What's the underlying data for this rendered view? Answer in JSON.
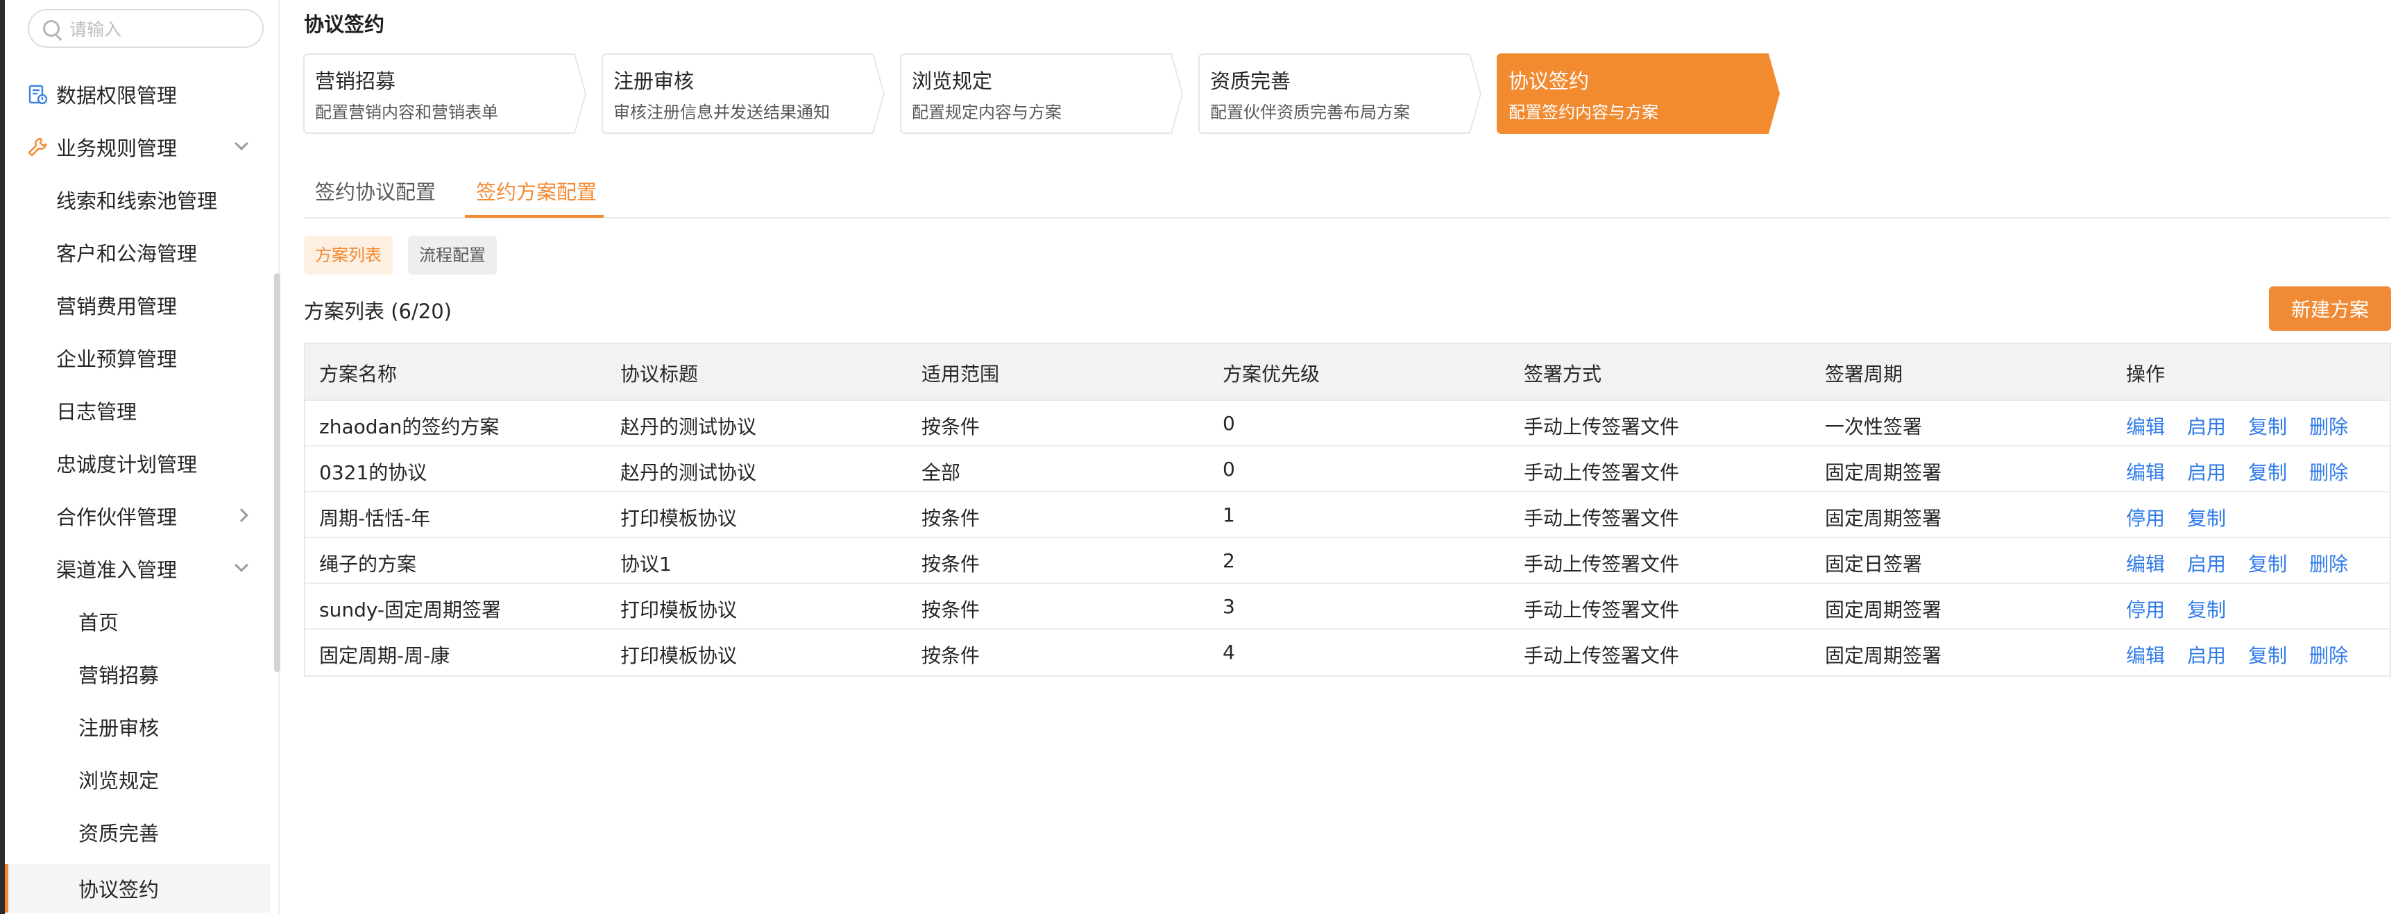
{
  "search": {
    "placeholder": "请输入"
  },
  "sidebar": {
    "items": [
      {
        "label": "数据权限管理"
      },
      {
        "label": "业务规则管理"
      },
      {
        "label": "线索和线索池管理"
      },
      {
        "label": "客户和公海管理"
      },
      {
        "label": "营销费用管理"
      },
      {
        "label": "企业预算管理"
      },
      {
        "label": "日志管理"
      },
      {
        "label": "忠诚度计划管理"
      },
      {
        "label": "合作伙伴管理"
      },
      {
        "label": "渠道准入管理"
      },
      {
        "label": "首页"
      },
      {
        "label": "营销招募"
      },
      {
        "label": "注册审核"
      },
      {
        "label": "浏览规定"
      },
      {
        "label": "资质完善"
      },
      {
        "label": "协议签约"
      }
    ],
    "active": "协议签约"
  },
  "page": {
    "title": "协议签约"
  },
  "steps": [
    {
      "title": "营销招募",
      "desc": "配置营销内容和营销表单"
    },
    {
      "title": "注册审核",
      "desc": "审核注册信息并发送结果通知"
    },
    {
      "title": "浏览规定",
      "desc": "配置规定内容与方案"
    },
    {
      "title": "资质完善",
      "desc": "配置伙伴资质完善布局方案"
    },
    {
      "title": "协议签约",
      "desc": "配置签约内容与方案"
    }
  ],
  "tabs": [
    {
      "label": "签约协议配置"
    },
    {
      "label": "签约方案配置"
    }
  ],
  "chips": [
    {
      "label": "方案列表"
    },
    {
      "label": "流程配置"
    }
  ],
  "list": {
    "title": "方案列表 (6/20)",
    "new_button": "新建方案"
  },
  "table": {
    "columns": [
      "方案名称",
      "协议标题",
      "适用范围",
      "方案优先级",
      "签署方式",
      "签署周期",
      "操作"
    ],
    "rows": [
      {
        "name": "zhaodan的签约方案",
        "agreement": "赵丹的测试协议",
        "scope": "按条件",
        "priority": "0",
        "sign_method": "手动上传签署文件",
        "cycle": "一次性签署",
        "ops": [
          "编辑",
          "启用",
          "复制",
          "删除"
        ]
      },
      {
        "name": "0321的协议",
        "agreement": "赵丹的测试协议",
        "scope": "全部",
        "priority": "0",
        "sign_method": "手动上传签署文件",
        "cycle": "固定周期签署",
        "ops": [
          "编辑",
          "启用",
          "复制",
          "删除"
        ]
      },
      {
        "name": "周期-恬恬-年",
        "agreement": "打印模板协议",
        "scope": "按条件",
        "priority": "1",
        "sign_method": "手动上传签署文件",
        "cycle": "固定周期签署",
        "ops": [
          "停用",
          "复制"
        ]
      },
      {
        "name": "绳子的方案",
        "agreement": "协议1",
        "scope": "按条件",
        "priority": "2",
        "sign_method": "手动上传签署文件",
        "cycle": "固定日签署",
        "ops": [
          "编辑",
          "启用",
          "复制",
          "删除"
        ]
      },
      {
        "name": "sundy-固定周期签署",
        "agreement": "打印模板协议",
        "scope": "按条件",
        "priority": "3",
        "sign_method": "手动上传签署文件",
        "cycle": "固定周期签署",
        "ops": [
          "停用",
          "复制"
        ]
      },
      {
        "name": "固定周期-周-康",
        "agreement": "打印模板协议",
        "scope": "按条件",
        "priority": "4",
        "sign_method": "手动上传签署文件",
        "cycle": "固定周期签署",
        "ops": [
          "编辑",
          "启用",
          "复制",
          "删除"
        ]
      }
    ]
  },
  "colors": {
    "accent": "#f28a30",
    "link": "#2f7bea",
    "step_bg": "#f7f7f7",
    "step_current_bg": "#f28a30"
  }
}
